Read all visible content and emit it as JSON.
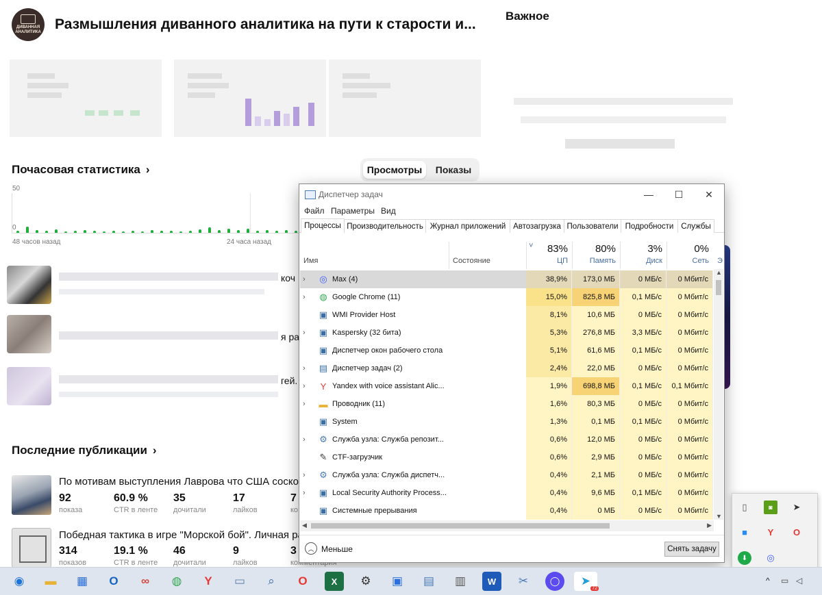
{
  "channel": {
    "avatar_text": "ДИВАННАЯ АНАЛИТИКА",
    "title": "Размышления диванного аналитика на пути к старости и..."
  },
  "important": {
    "title": "Важное"
  },
  "hourly": {
    "title": "Почасовая статистика",
    "chevron": "›",
    "tabs": [
      "Просмотры",
      "Показы"
    ],
    "y_max": "50",
    "y_min": "0",
    "x_labels": [
      "48 часов назад",
      "24 часа назад"
    ]
  },
  "partial_rows": [
    "коч",
    "я ра",
    "гей."
  ],
  "publications": {
    "title": "Последние публикации",
    "chevron": "›",
    "items": [
      {
        "title": "По мотивам выступления Лаврова что США соскоч",
        "stats": [
          {
            "value": "92",
            "label": "показа"
          },
          {
            "value": "60.9 %",
            "label": "CTR в ленте"
          },
          {
            "value": "35",
            "label": "дочитали"
          },
          {
            "value": "17",
            "label": "лайков"
          },
          {
            "value": "7",
            "label": "ко"
          }
        ]
      },
      {
        "title": "Победная тактика в игре \"Морской бой\". Личная ра",
        "stats": [
          {
            "value": "314",
            "label": "показов"
          },
          {
            "value": "19.1 %",
            "label": "CTR в ленте"
          },
          {
            "value": "46",
            "label": "дочитали"
          },
          {
            "value": "9",
            "label": "лайков"
          },
          {
            "value": "3",
            "label": "комментария"
          }
        ]
      }
    ]
  },
  "task_manager": {
    "title": "Диспетчер задач",
    "window_controls": {
      "minimize": "—",
      "maximize": "☐",
      "close": "✕"
    },
    "menu": [
      "Файл",
      "Параметры",
      "Вид"
    ],
    "tabs": [
      "Процессы",
      "Производительность",
      "Журнал приложений",
      "Автозагрузка",
      "Пользователи",
      "Подробности",
      "Службы"
    ],
    "columns": {
      "name": "Имя",
      "status": "Состояние",
      "cpu": {
        "pct": "83%",
        "label": "ЦП"
      },
      "memory": {
        "pct": "80%",
        "label": "Память"
      },
      "disk": {
        "pct": "3%",
        "label": "Диск"
      },
      "net": {
        "pct": "0%",
        "label": "Сеть"
      },
      "extra": "Э"
    },
    "sort_arrow": "˅",
    "processes": [
      {
        "expand": "›",
        "icon": "max-app-icon",
        "name": "Max (4)",
        "cpu": "38,9%",
        "mem": "173,0 МБ",
        "disk": "0 МБ/с",
        "net": "0 Мбит/с"
      },
      {
        "expand": "›",
        "icon": "chrome-icon",
        "name": "Google Chrome (11)",
        "cpu": "15,0%",
        "mem": "825,8 МБ",
        "disk": "0,1 МБ/с",
        "net": "0 Мбит/с"
      },
      {
        "expand": "",
        "icon": "wmi-icon",
        "name": "WMI Provider Host",
        "cpu": "8,1%",
        "mem": "10,6 МБ",
        "disk": "0 МБ/с",
        "net": "0 Мбит/с"
      },
      {
        "expand": "›",
        "icon": "kaspersky-icon",
        "name": "Kaspersky (32 бита)",
        "cpu": "5,3%",
        "mem": "276,8 МБ",
        "disk": "3,3 МБ/с",
        "net": "0 Мбит/с"
      },
      {
        "expand": "",
        "icon": "dwm-icon",
        "name": "Диспетчер окон рабочего стола",
        "cpu": "5,1%",
        "mem": "61,6 МБ",
        "disk": "0,1 МБ/с",
        "net": "0 Мбит/с"
      },
      {
        "expand": "›",
        "icon": "taskmgr-icon",
        "name": "Диспетчер задач (2)",
        "cpu": "2,4%",
        "mem": "22,0 МБ",
        "disk": "0 МБ/с",
        "net": "0 Мбит/с"
      },
      {
        "expand": "›",
        "icon": "yandex-icon",
        "name": "Yandex with voice assistant Alic...",
        "cpu": "1,9%",
        "mem": "698,8 МБ",
        "disk": "0,1 МБ/с",
        "net": "0,1 Мбит/с"
      },
      {
        "expand": "›",
        "icon": "explorer-icon",
        "name": "Проводник (11)",
        "cpu": "1,6%",
        "mem": "80,3 МБ",
        "disk": "0 МБ/с",
        "net": "0 Мбит/с"
      },
      {
        "expand": "",
        "icon": "system-icon",
        "name": "System",
        "cpu": "1,3%",
        "mem": "0,1 МБ",
        "disk": "0,1 МБ/с",
        "net": "0 Мбит/с"
      },
      {
        "expand": "›",
        "icon": "service-host-icon",
        "name": "Служба узла: Служба репозит...",
        "cpu": "0,6%",
        "mem": "12,0 МБ",
        "disk": "0 МБ/с",
        "net": "0 Мбит/с"
      },
      {
        "expand": "",
        "icon": "ctf-icon",
        "name": "CTF-загрузчик",
        "cpu": "0,6%",
        "mem": "2,9 МБ",
        "disk": "0 МБ/с",
        "net": "0 Мбит/с"
      },
      {
        "expand": "›",
        "icon": "service-host-icon",
        "name": "Служба узла: Служба диспетч...",
        "cpu": "0,4%",
        "mem": "2,1 МБ",
        "disk": "0 МБ/с",
        "net": "0 Мбит/с"
      },
      {
        "expand": "›",
        "icon": "lsa-icon",
        "name": "Local Security Authority Process...",
        "cpu": "0,4%",
        "mem": "9,6 МБ",
        "disk": "0,1 МБ/с",
        "net": "0 Мбит/с"
      },
      {
        "expand": "",
        "icon": "interrupts-icon",
        "name": "Системные прерывания",
        "cpu": "0,4%",
        "mem": "0 МБ",
        "disk": "0 МБ/с",
        "net": "0 Мбит/с"
      }
    ],
    "fewer_details": "Меньше",
    "end_task": "Снять задачу"
  },
  "colors": {
    "cpu_high": "#f9e28a",
    "cpu_mid": "#fbe9a6",
    "cpu_low": "#fff4c4",
    "mem_high": "#f7d376",
    "mem_low": "#fff4c4",
    "sparkline": "#1fae3c",
    "selected_row": "#d9d9d9"
  },
  "tray_popup": {
    "icons": [
      "usb-drive-icon",
      "nvidia-icon",
      "telegram-icon",
      "blue-flag-icon",
      "yandex-tray-icon",
      "opera-tray-icon",
      "kaspersky-tray-icon",
      "max-tray-icon"
    ]
  },
  "taskbar": {
    "icons": [
      "globe-icon",
      "folder-icon",
      "store-icon",
      "outlook-icon",
      "infinity-app-icon",
      "chrome-taskbar-icon",
      "yandex-taskbar-icon",
      "vm-icon",
      "search-doc-icon",
      "opera-taskbar-icon",
      "excel-icon",
      "settings-gear-icon",
      "control-panel-icon",
      "notepad-icon",
      "calculator-icon",
      "word-icon",
      "snip-icon",
      "max-taskbar-icon",
      "telegram-taskbar-icon"
    ],
    "telegram_badge": "72",
    "sys_caret": "^"
  }
}
